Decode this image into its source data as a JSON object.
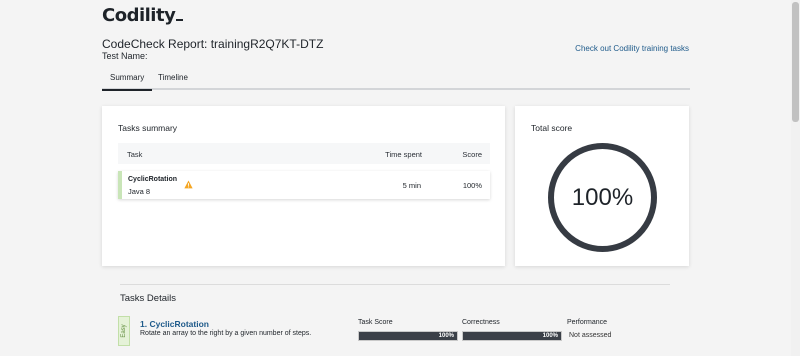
{
  "header": {
    "logo_text": "Codility",
    "report_title": "CodeCheck Report: trainingR2Q7KT-DTZ",
    "test_name_label": "Test Name:",
    "training_link": "Check out Codility training tasks"
  },
  "tabs": [
    {
      "label": "Summary",
      "active": true
    },
    {
      "label": "Timeline",
      "active": false
    }
  ],
  "tasks_summary": {
    "title": "Tasks summary",
    "columns": {
      "task": "Task",
      "time": "Time spent",
      "score": "Score"
    },
    "rows": [
      {
        "name": "CyclicRotation",
        "language": "Java 8",
        "time": "5 min",
        "score": "100%",
        "warning_icon": "warning-triangle-icon"
      }
    ]
  },
  "total_score": {
    "title": "Total score",
    "value": "100%",
    "fraction": 1.0
  },
  "tasks_details": {
    "title": "Tasks Details",
    "items": [
      {
        "difficulty": "Easy",
        "number": "1.",
        "name": "CyclicRotation",
        "description": "Rotate an array to the right by a given number of steps.",
        "task_score_label": "Task Score",
        "task_score": "100%",
        "task_score_fraction": 1.0,
        "correctness_label": "Correctness",
        "correctness": "100%",
        "correctness_fraction": 1.0,
        "performance_label": "Performance",
        "performance": "Not assessed"
      }
    ]
  },
  "colors": {
    "accent_link": "#1e5a8a",
    "dark": "#1e2329",
    "success_green": "#c9e5b8",
    "warning": "#f5a623"
  }
}
